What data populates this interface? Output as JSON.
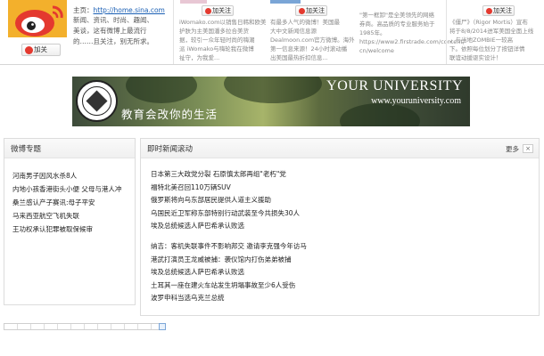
{
  "top": {
    "homepage_prefix": "主页：",
    "homepage_url": "http://home.sina.com",
    "intro_lines": [
      "新闻、资讯、时尚、趣闻、",
      "美谈，这有微博上最流行",
      "的……且关注，别无所求。"
    ],
    "follow_label": "加关",
    "follow_small_label": "加关注",
    "columns": [
      {
        "lines": [
          "iWomako.com以销售日韩和欧美",
          "护肤为主美国潘多拉合美货",
          "据，较引一众年轻时尚的嗨潮",
          "派 iWomako与嗨轮我在微博",
          "祉守，为我爱..."
        ]
      },
      {
        "lines": [
          "有最多人气的微博！美国最",
          "大中文新闻信息源",
          "Dealmoon.com官方微博。海外",
          "第一信息来源！24小时滚动播",
          "出美国最热折扣信息..."
        ]
      },
      {
        "lines": [
          "\"第一框卸\"是全美领先的网络",
          "券商。高品质的专业服务始于",
          "1985年。",
          "https://www2.firstrade.com/content/",
          "cn/welcome"
        ]
      },
      {
        "lines": [
          "《僵尸》（Rigor Mortis）宣布",
          "将于8/8/2014进军美国全面上线",
          "，与当地ZOMBIE一较高",
          "下。依照每位划分了按钮详情",
          "联谊动援驱实设计！"
        ]
      }
    ]
  },
  "banner": {
    "title": "YOUR UNIVERSITY",
    "url": "www.youruniversity.com",
    "motto": "教育会改你的生活"
  },
  "weibo_topics": {
    "title": "微博专题",
    "items": [
      "河南男子因风水杀8人",
      "内地小孩香港街头小便 父母与港人冲",
      "桑兰感认产子赛讯:母子平安",
      "马来西亚航空飞机失联",
      "王功权承认犯罪被取保候审"
    ]
  },
  "news": {
    "title": "即时新闻滚动",
    "more_label": "更多",
    "close_label": "×",
    "group1": [
      "日本第三大政党分裂 石原慎太郎再组\"老朽\"党",
      "福特北美召回110万辆SUV",
      "俄罗斯将向乌东部居民提供人道主义援助",
      "乌国民近卫军称东部特别行动武装至今共损失30人",
      "埃及总统候选人萨巴希承认败选"
    ],
    "group2": [
      "纳吉：客机失联事件不影响邦交 邀请李克强今年访马",
      "港武打演员王龙威被捕：袭仪馆内打伤弟弟被捕",
      "埃及总统候选人萨巴希承认败选",
      "土耳其一座在建火车站发生坍塌事故至少6人受伤",
      "波罗申科当选乌克兰总统"
    ]
  },
  "colors": {
    "link_blue": "#1a5fb4",
    "weibo_red": "#e4392f",
    "panel_border": "#dcdcdc"
  }
}
